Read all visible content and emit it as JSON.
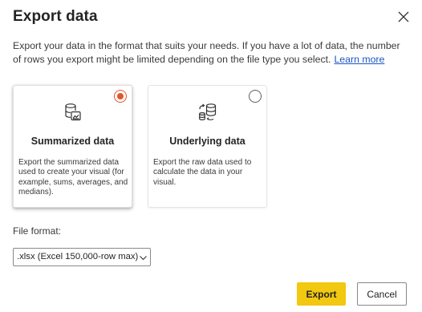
{
  "dialog": {
    "title": "Export data",
    "description": "Export your data in the format that suits your needs. If you have a lot of data, the number of rows you export might be limited depending on the file type you select.",
    "learn_more": "Learn more"
  },
  "options": [
    {
      "title": "Summarized data",
      "description": "Export the summarized data used to create your visual (for example, sums, averages, and medians).",
      "selected": true,
      "icon": "database-chart-icon"
    },
    {
      "title": "Underlying data",
      "description": "Export the raw data used to calculate the data in your visual.",
      "selected": false,
      "icon": "database-refresh-icon"
    }
  ],
  "file_format": {
    "label": "File format:",
    "value": ".xlsx (Excel 150,000-row max)"
  },
  "buttons": {
    "export": "Export",
    "cancel": "Cancel"
  },
  "colors": {
    "accent_radio": "#e4562a",
    "primary_button": "#f2c811",
    "link": "#1b55c4"
  }
}
